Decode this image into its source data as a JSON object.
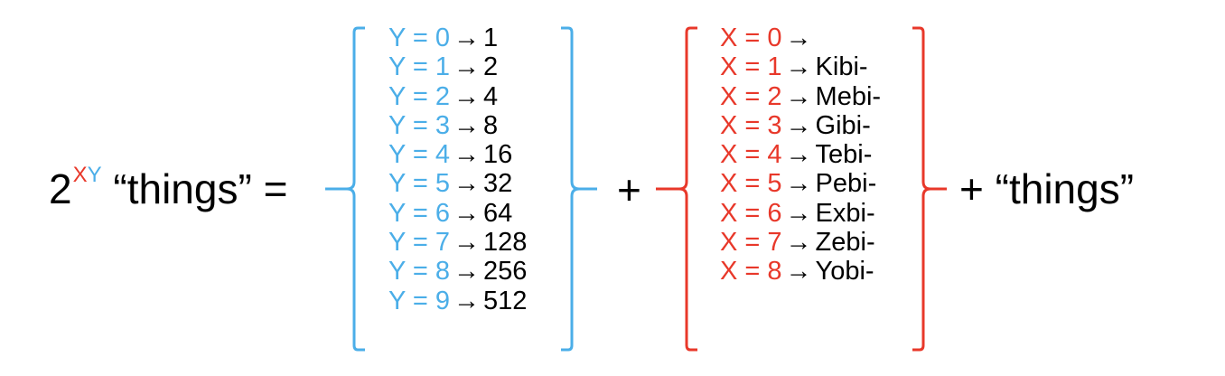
{
  "colors": {
    "y_color": "#4BAEE8",
    "x_color": "#E8382A",
    "text": "#000000",
    "background": "#ffffff"
  },
  "formula": {
    "base": "2",
    "exp_x": "X",
    "exp_y": "Y",
    "things_left": "“things” =",
    "plus_1": "+",
    "plus_things": "+ “things”"
  },
  "y_table": {
    "rows": [
      {
        "label": "Y = 0",
        "arrow": "→",
        "value": "1"
      },
      {
        "label": "Y = 1",
        "arrow": "→",
        "value": "2"
      },
      {
        "label": "Y = 2",
        "arrow": "→",
        "value": "4"
      },
      {
        "label": "Y = 3",
        "arrow": "→",
        "value": "8"
      },
      {
        "label": "Y = 4",
        "arrow": "→",
        "value": "16"
      },
      {
        "label": "Y = 5",
        "arrow": "→",
        "value": "32"
      },
      {
        "label": "Y = 6",
        "arrow": "→",
        "value": "64"
      },
      {
        "label": "Y = 7",
        "arrow": "→",
        "value": "128"
      },
      {
        "label": "Y = 8",
        "arrow": "→",
        "value": "256"
      },
      {
        "label": "Y = 9",
        "arrow": "→",
        "value": "512"
      }
    ]
  },
  "x_table": {
    "rows": [
      {
        "label": "X = 0",
        "arrow": "→",
        "value": ""
      },
      {
        "label": "X = 1",
        "arrow": "→",
        "value": "Kibi-"
      },
      {
        "label": "X = 2",
        "arrow": "→",
        "value": "Mebi-"
      },
      {
        "label": "X = 3",
        "arrow": "→",
        "value": "Gibi-"
      },
      {
        "label": "X = 4",
        "arrow": "→",
        "value": "Tebi-"
      },
      {
        "label": "X = 5",
        "arrow": "→",
        "value": "Pebi-"
      },
      {
        "label": "X = 6",
        "arrow": "→",
        "value": "Exbi-"
      },
      {
        "label": "X = 7",
        "arrow": "→",
        "value": "Zebi-"
      },
      {
        "label": "X = 8",
        "arrow": "→",
        "value": "Yobi-"
      }
    ]
  }
}
